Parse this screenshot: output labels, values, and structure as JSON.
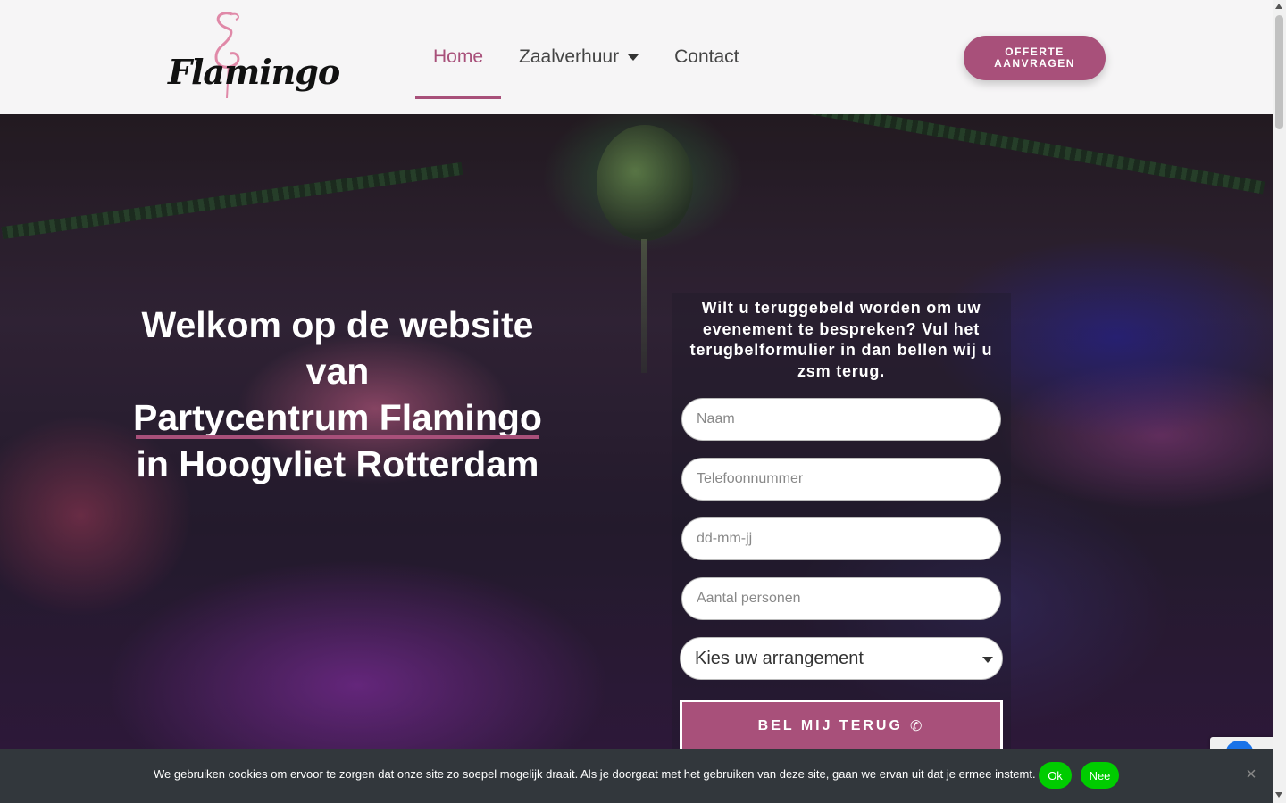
{
  "logo": {
    "text": "Flamingo",
    "icon": "flamingo-icon"
  },
  "nav": {
    "items": [
      {
        "label": "Home",
        "active": true
      },
      {
        "label": "Zaalverhuur",
        "has_dropdown": true
      },
      {
        "label": "Contact"
      }
    ]
  },
  "header": {
    "cta_line1": "OFFERTE",
    "cta_line2": "AANVRAGEN"
  },
  "hero": {
    "title_line1": "Welkom op de website",
    "title_line2": "van",
    "title_line3": "Partycentrum Flamingo",
    "title_line4": "in Hoogvliet Rotterdam"
  },
  "form": {
    "heading": "Wilt u teruggebeld worden om uw evenement te bespreken? Vul het terugbelformulier in dan bellen wij u zsm terug.",
    "name_placeholder": "Naam",
    "phone_placeholder": "Telefoonnummer",
    "date_placeholder": "dd-mm-jj",
    "persons_placeholder": "Aantal personen",
    "arrangement_selected": "Kies uw arrangement",
    "submit_label": "BEL MIJ TERUG"
  },
  "cookie": {
    "text": "We gebruiken cookies om ervoor te zorgen dat onze site zo soepel mogelijk draait. Als je doorgaat met het gebruiken van deze site, gaan we ervan uit dat je ermee instemt.",
    "ok_label": "Ok",
    "no_label": "Nee"
  },
  "colors": {
    "accent": "#a8507a",
    "cookie_bg": "#32373c",
    "cookie_button": "#00cc00"
  }
}
